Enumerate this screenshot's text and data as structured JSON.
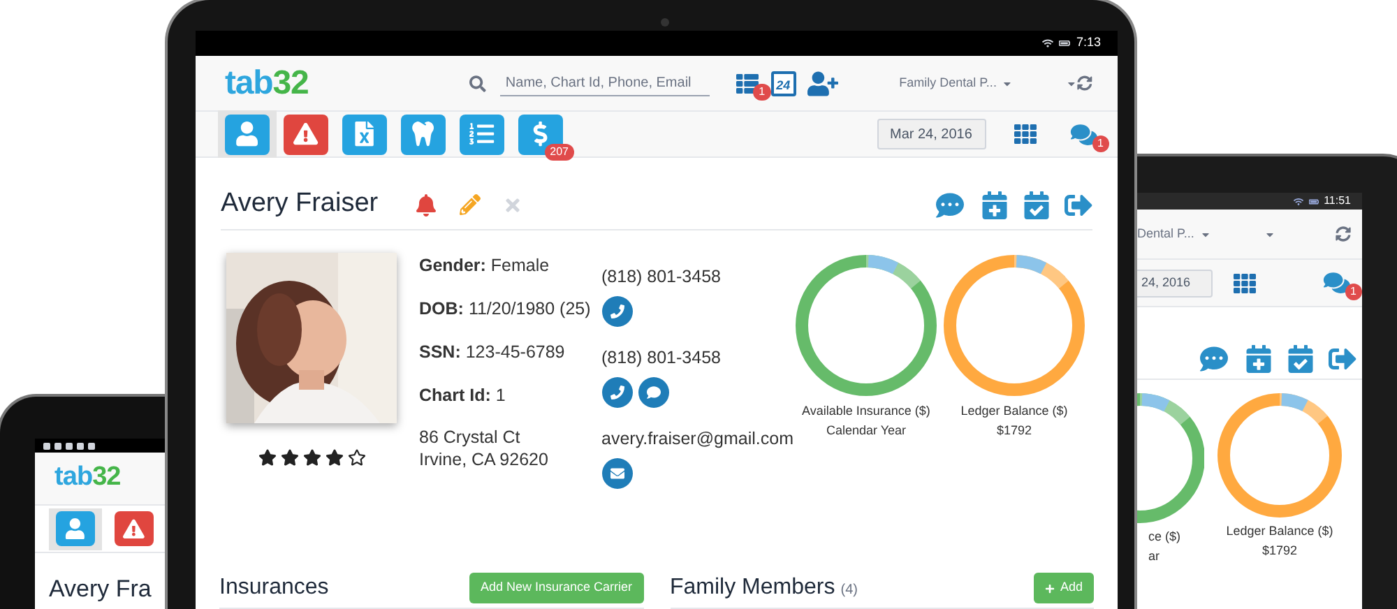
{
  "left_phone": {
    "logo": [
      "tab",
      "32"
    ],
    "module_tabs": [
      {
        "kind": "patient",
        "selected": true
      },
      {
        "kind": "alert",
        "selected": false
      }
    ],
    "patient_name": "Avery Fra"
  },
  "right_tablet": {
    "status_time": "11:51",
    "practice": "Dental P...",
    "date": "24, 2016",
    "messages_badge": "1",
    "gauges": [
      {
        "label_lines": [
          "ce ($)",
          "ar"
        ],
        "color": "#66bb6a"
      },
      {
        "label_lines": [
          "Ledger Balance ($)",
          "$1792"
        ],
        "color": "#ffa940"
      }
    ]
  },
  "main_tablet": {
    "status_time": "7:13",
    "logo": [
      "tab",
      "32"
    ],
    "search": {
      "placeholder": "Name, Chart Id, Phone, Email"
    },
    "header_icons": [
      {
        "kind": "list",
        "badge": "1"
      },
      {
        "kind": "calendar",
        "label": "24"
      },
      {
        "kind": "add-user"
      }
    ],
    "practice": "Family Dental P...",
    "module_tabs": [
      {
        "kind": "patient",
        "selected": true
      },
      {
        "kind": "alert",
        "selected": false
      },
      {
        "kind": "excel",
        "selected": false
      },
      {
        "kind": "tooth",
        "selected": false
      },
      {
        "kind": "list",
        "selected": false
      },
      {
        "kind": "billing",
        "selected": false,
        "badge": "207"
      }
    ],
    "date": "Mar 24, 2016",
    "messages_badge": "1",
    "patient": {
      "name": "Avery Fraiser",
      "stars": 4,
      "fields": [
        {
          "label": "Gender:",
          "value": "Female"
        },
        {
          "label": "DOB:",
          "value": "11/20/1980 (25)"
        },
        {
          "label": "SSN:",
          "value": "123-45-6789"
        },
        {
          "label": "Chart Id:",
          "value": "1"
        }
      ],
      "address": [
        "86 Crystal Ct",
        "Irvine, CA 92620"
      ],
      "contacts": [
        {
          "value": "(818) 801-3458",
          "actions": [
            {
              "kind": "phone"
            }
          ]
        },
        {
          "value": "(818) 801-3458",
          "actions": [
            {
              "kind": "phone"
            },
            {
              "kind": "sms"
            }
          ]
        },
        {
          "value": "avery.fraiser@gmail.com",
          "actions": [
            {
              "kind": "email"
            }
          ]
        }
      ]
    },
    "gauges": [
      {
        "label_lines": [
          "Available Insurance ($)",
          "Calendar Year"
        ],
        "color": "#66bb6a"
      },
      {
        "label_lines": [
          "Ledger Balance ($)",
          "$1792"
        ],
        "color": "#ffa940"
      }
    ],
    "sections": [
      {
        "title": "Insurances",
        "button": {
          "label": "Add New Insurance Carrier",
          "kind": "text"
        }
      },
      {
        "title": "Family Members",
        "count": "(4)",
        "button": {
          "label": "Add",
          "kind": "plus"
        }
      }
    ]
  }
}
